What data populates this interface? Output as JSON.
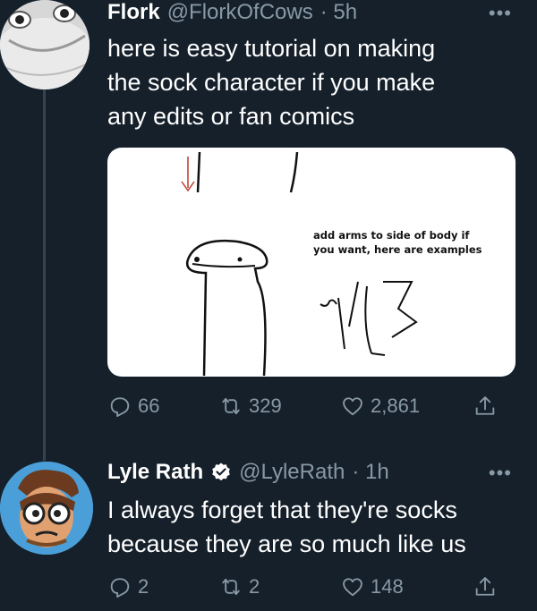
{
  "tweet1": {
    "name": "Flork",
    "handle": "@FlorkOfCows",
    "time": "· 5h",
    "text_lines": [
      "here is easy tutorial on making",
      "the sock character if you make",
      "any edits or fan comics"
    ],
    "media": {
      "caption_lines": [
        "add arms to side of body if",
        "you want, here are examples"
      ]
    },
    "replies": "66",
    "retweets": "329",
    "likes": "2,861"
  },
  "tweet2": {
    "name": "Lyle Rath",
    "handle": "@LyleRath",
    "time": "· 1h",
    "text_lines": [
      "I always forget that they're socks",
      "because they are so much like us"
    ],
    "replies": "2",
    "retweets": "2",
    "likes": "148"
  },
  "colors": {
    "background": "#15202b",
    "secondary_text": "#8899a6",
    "verified": "#ffffff"
  },
  "icons": {
    "reply": "reply-icon",
    "retweet": "retweet-icon",
    "like": "heart-icon",
    "share": "share-icon",
    "more": "more-icon",
    "verified": "verified-icon"
  }
}
